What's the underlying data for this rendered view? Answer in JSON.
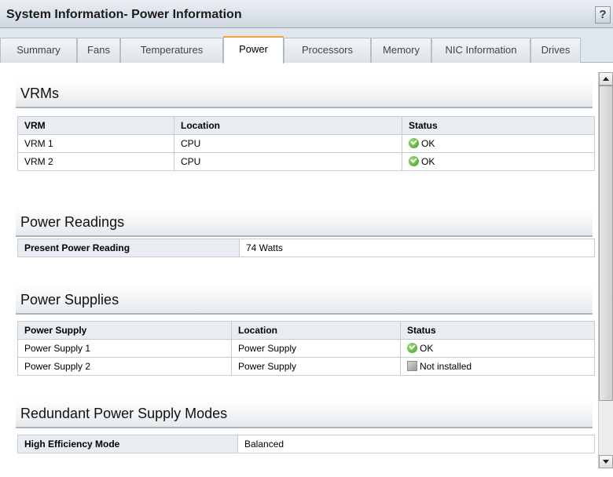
{
  "window": {
    "title": "System Information- Power Information",
    "help_label": "?"
  },
  "tabs": [
    {
      "label": "Summary"
    },
    {
      "label": "Fans"
    },
    {
      "label": "Temperatures"
    },
    {
      "label": "Power"
    },
    {
      "label": "Processors"
    },
    {
      "label": "Memory"
    },
    {
      "label": "NIC Information"
    },
    {
      "label": "Drives"
    }
  ],
  "active_tab": "Power",
  "vrms": {
    "heading": "VRMs",
    "headers": [
      "VRM",
      "Location",
      "Status"
    ],
    "rows": [
      {
        "name": "VRM 1",
        "location": "CPU",
        "status": "OK",
        "status_icon": "ok-check-icon"
      },
      {
        "name": "VRM 2",
        "location": "CPU",
        "status": "OK",
        "status_icon": "ok-check-icon"
      }
    ]
  },
  "power_readings": {
    "heading": "Power Readings",
    "label": "Present Power Reading",
    "value": "74 Watts"
  },
  "power_supplies": {
    "heading": "Power Supplies",
    "headers": [
      "Power Supply",
      "Location",
      "Status"
    ],
    "rows": [
      {
        "name": "Power Supply 1",
        "location": "Power Supply",
        "status": "OK",
        "status_icon": "ok-check-icon"
      },
      {
        "name": "Power Supply 2",
        "location": "Power Supply",
        "status": "Not installed",
        "status_icon": "not-installed-icon"
      }
    ]
  },
  "redundant_modes": {
    "heading": "Redundant Power Supply Modes",
    "label": "High Efficiency Mode",
    "value": "Balanced"
  },
  "colors": {
    "active_tab_accent": "#f0a23a",
    "ok_green": "#3d9a1f",
    "header_bg": "#e9edf1"
  }
}
